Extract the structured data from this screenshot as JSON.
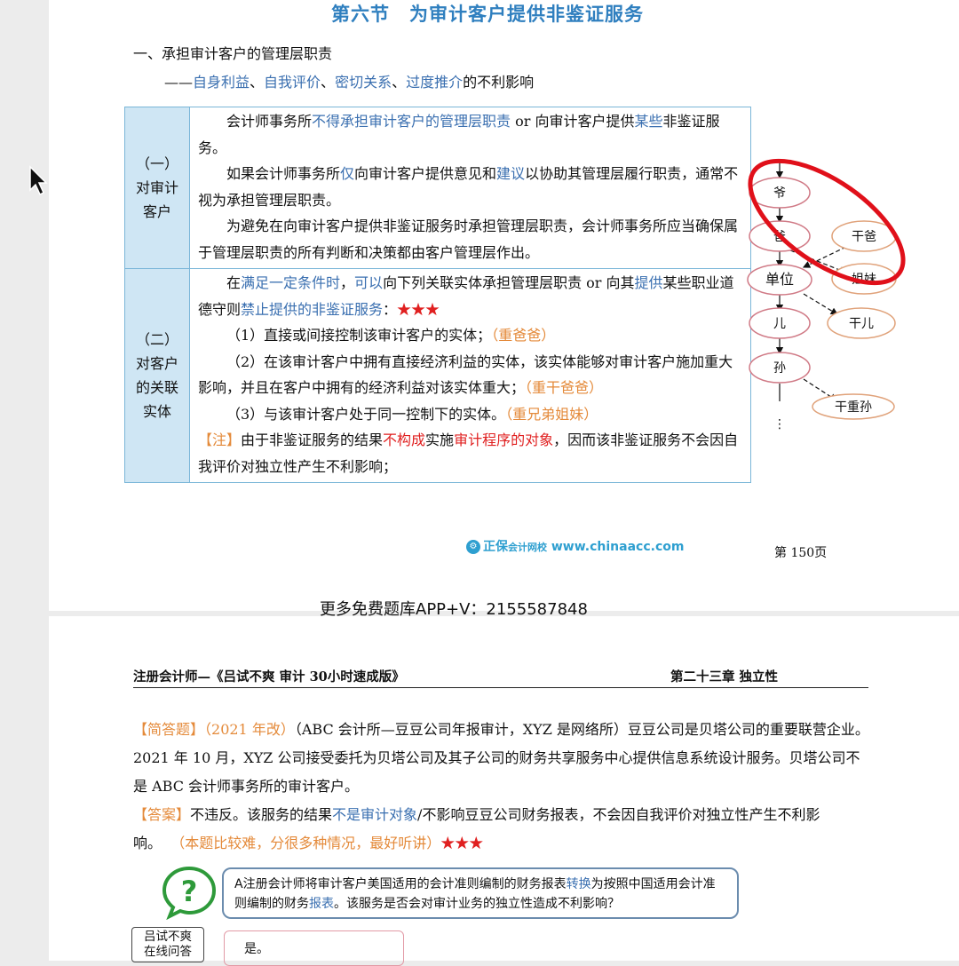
{
  "page1": {
    "title": "第六节　为审计客户提供非鉴证服务",
    "heading1": "一、承担审计客户的管理层职责",
    "heading2_prefix": "——",
    "heading2_items": [
      "自身利益",
      "自我评价",
      "密切关系",
      "过度推介"
    ],
    "heading2_seps": [
      "、",
      "、",
      "、"
    ],
    "heading2_suffix": "的不利影响",
    "row1": {
      "label_lines": [
        "（一）",
        "对审计",
        "客户"
      ],
      "p1_a": "会计师事务所",
      "p1_b": "不得承担审计客户的管理层职责",
      "p1_c": " or 向审计客户提供",
      "p1_d": "某些",
      "p1_e": "非鉴证服务。",
      "p2_a": "如果会计师事务所",
      "p2_b": "仅",
      "p2_c": "向审计客户提供意见和",
      "p2_d": "建议",
      "p2_e": "以协助其管理层履行职责，通常不视为承担管理层职责。",
      "p3": "为避免在向审计客户提供非鉴证服务时承担管理层职责，会计师事务所应当确保属于管理层职责的所有判断和决策都由客户管理层作出。"
    },
    "row2": {
      "label_lines": [
        "（二）",
        "对客户",
        "的关联",
        "实体"
      ],
      "p1_a": "在",
      "p1_b": "满足一定条件时",
      "p1_c": "，",
      "p1_d": "可以",
      "p1_e": "向下列关联实体承担管理层职责 or 向其",
      "p1_f": "提供",
      "p1_g": "某些职业道德守则",
      "p1_h": "禁止提供的非鉴证服务",
      "p1_i": "：",
      "p1_stars": "★★★",
      "i1_a": "（1）直接或间接控制该审计客户的实体；",
      "i1_b": "（重爸爸）",
      "i2_a": "（2）在该审计客户中拥有直接经济利益的实体，该实体能够对审计客户施加重大影响，并且在客户中拥有的经济利益对该实体重大；",
      "i2_b": "（重干爸爸）",
      "i3_a": "（3）与该审计客户处于同一控制下的实体。",
      "i3_b": "（重兄弟姐妹）",
      "note_a": "【注】",
      "note_b": "由于非鉴证服务的结果",
      "note_c": "不构成",
      "note_d": "实施",
      "note_e": "审计程序的对象",
      "note_f": "，因而该非鉴证服务不会因自我评价对独立性产生不利影响；"
    },
    "diagram": {
      "nodes": [
        "爷",
        "爸",
        "干爸",
        "单位",
        "姐妹",
        "儿",
        "干儿",
        "孙",
        "干重孙"
      ],
      "ellipsis": "⋮"
    },
    "logo_text": "正保",
    "logo_sub": "会计网校",
    "logo_url": "www.chinaacc.com",
    "page_number": "第 150页"
  },
  "promo": "更多免费题库APP+V：2155587848",
  "page2": {
    "header_left": "注册会计师—《吕试不爽 审计 30小时速成版》",
    "header_right": "第二十三章 独立性",
    "q_tag": "【简答题】",
    "q_year": "（2021 年改）",
    "q_text": "（ABC 会计所—豆豆公司年报审计，XYZ 是网络所）豆豆公司是贝塔公司的重要联营企业。2021 年 10 月，XYZ 公司接受委托为贝塔公司及其子公司的财务共享服务中心提供信息系统设计服务。贝塔公司不是 ABC 会计师事务所的审计客户。",
    "a_tag": "【答案】",
    "a_text1": "不违反。该服务的结果",
    "a_text2": "不是审计对象",
    "a_text3": "/不影响豆豆公司财务报表，不会因自我评价对独立性产生不利影响。",
    "a_note": "（本题比较难，分很多种情况，最好听讲）",
    "a_stars": "★★★",
    "bubble_a": "A注册会计师将审计客户美国适用的会计准则编制的财务报表",
    "bubble_b": "转换",
    "bubble_c": "为按照中国适用会计准则编制的财务",
    "bubble_d": "报表",
    "bubble_e": "。该服务是否会对审计业务的独立性造成不利影响？",
    "answer": "是。",
    "lyu_lines": [
      "吕试不爽",
      "在线问答"
    ]
  },
  "colors": {
    "title_blue": "#2f7fbf",
    "emph_blue": "#3a6fb0",
    "orange": "#e48a3a",
    "red": "#e02020",
    "table_label_bg": "#cfe6f4"
  }
}
